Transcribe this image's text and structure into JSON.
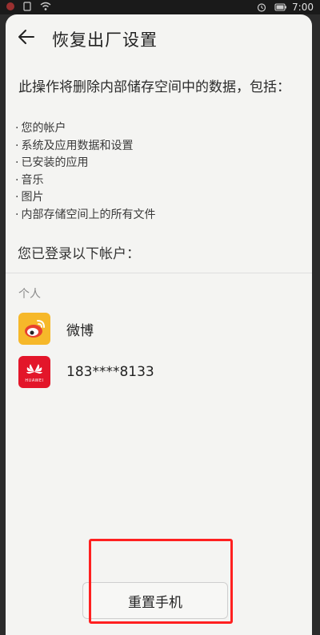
{
  "status_bar": {
    "time": "7:00",
    "left_icons": [
      "notification-icon",
      "sim-icon",
      "wifi-icon"
    ],
    "right_icons": [
      "alarm-icon",
      "battery-icon"
    ]
  },
  "header": {
    "back_icon": "back-arrow-icon",
    "title": "恢复出厂设置"
  },
  "description": "此操作将删除内部储存空间中的数据，包括：",
  "bullet_marker": "·",
  "items": [
    "您的帐户",
    "系统及应用数据和设置",
    "已安装的应用",
    "音乐",
    "图片",
    "内部存储空间上的所有文件"
  ],
  "logged_in_label": "您已登录以下帐户：",
  "accounts_section": {
    "label": "个人",
    "accounts": [
      {
        "icon": "weibo-icon",
        "name": "微博",
        "color": "#f6b82a"
      },
      {
        "icon": "huawei-icon",
        "name": "183****8133",
        "color": "#e3162a",
        "logo_text": "HUAWEI"
      }
    ]
  },
  "reset_button": {
    "label": "重置手机"
  },
  "colors": {
    "background": "#f4f4f2",
    "highlight": "#ff2020"
  }
}
